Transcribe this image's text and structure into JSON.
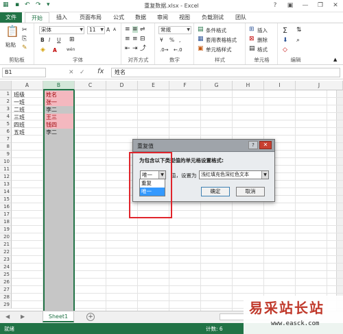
{
  "window": {
    "title": "重复数据.xlsx - Excel",
    "controls": [
      "?",
      "▣",
      "—",
      "❐",
      "✕"
    ]
  },
  "ribbon_tabs": [
    "文件",
    "开始",
    "插入",
    "页面布局",
    "公式",
    "数据",
    "审阅",
    "视图",
    "负载测试",
    "团队"
  ],
  "ribbon": {
    "clipboard": {
      "label": "剪贴板",
      "paste": "粘贴"
    },
    "font": {
      "label": "字体",
      "font_name": "宋体",
      "font_size": "11",
      "bold": "B",
      "italic": "I",
      "underline": "U",
      "grow": "A",
      "shrink": "A",
      "color": "A",
      "wen": "wén"
    },
    "alignment": {
      "label": "对齐方式"
    },
    "number": {
      "label": "数字",
      "format": "常规",
      "percent": "%",
      "comma": ",",
      "currency": "¥"
    },
    "styles": {
      "label": "样式",
      "conditional": "条件格式",
      "table": "套用表格格式",
      "cell_styles": "单元格样式"
    },
    "cells": {
      "label": "单元格",
      "insert": "插入",
      "delete": "删除",
      "format": "格式"
    },
    "editing": {
      "label": "编辑",
      "sum": "Σ"
    }
  },
  "formula_bar": {
    "name_box": "B1",
    "fx": "fx",
    "content": "姓名"
  },
  "columns": [
    "A",
    "B",
    "C",
    "D",
    "E",
    "F",
    "G",
    "H",
    "I",
    "J"
  ],
  "rows": [
    "1",
    "2",
    "3",
    "4",
    "5",
    "6",
    "7",
    "8",
    "9",
    "10",
    "11",
    "12",
    "13",
    "14",
    "15",
    "16",
    "17",
    "18",
    "19",
    "20",
    "21",
    "22",
    "23",
    "24",
    "25",
    "26",
    "27",
    "28",
    "29"
  ],
  "cells": {
    "A": [
      "班级",
      "一班",
      "二班",
      "三班",
      "四班",
      "五班"
    ],
    "B": [
      "姓名",
      "张一",
      "李二",
      "王三",
      "钱四",
      "李二"
    ]
  },
  "dialog": {
    "title": "重复值",
    "prompt": "为包含以下类型值的单元格设置格式:",
    "select_value": "唯一",
    "set_to": "值，设置为",
    "format_value": "浅红填充色深红色文本",
    "ok": "确定",
    "cancel": "取消",
    "help": "?",
    "close": "✕",
    "options": [
      "重复",
      "唯一"
    ]
  },
  "sheet_tabs": [
    "Sheet1"
  ],
  "status": {
    "ready": "就绪",
    "count": "计数: 6"
  },
  "watermark": {
    "big": "易采站长站",
    "small": "www.easck.com"
  },
  "colors": {
    "excel_green": "#217346",
    "duplicate_fill": "#f4b8bf",
    "duplicate_text": "#9c0006",
    "annotation_red": "#e0242b"
  }
}
